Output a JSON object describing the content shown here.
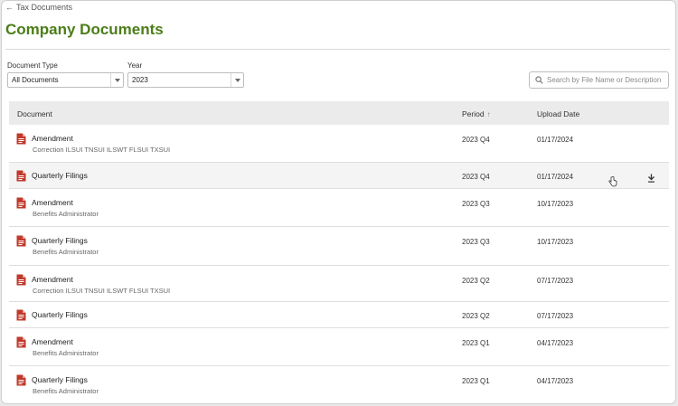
{
  "nav": {
    "back_label": "Tax Documents"
  },
  "page": {
    "title": "Company Documents"
  },
  "filters": {
    "document_type_label": "Document Type",
    "document_type_value": "All Documents",
    "year_label": "Year",
    "year_value": "2023",
    "search_placeholder": "Search by File Name or Description"
  },
  "table": {
    "columns": {
      "document": "Document",
      "period": "Period",
      "upload_date": "Upload Date"
    },
    "rows": [
      {
        "name": "Amendment",
        "desc": "Correction ILSUI TNSUI ILSWT FLSUI TXSUI",
        "period": "2023 Q4",
        "date": "01/17/2024"
      },
      {
        "name": "Quarterly Filings",
        "desc": "",
        "period": "2023 Q4",
        "date": "01/17/2024"
      },
      {
        "name": "Amendment",
        "desc": "Benefits Administrator",
        "period": "2023 Q3",
        "date": "10/17/2023"
      },
      {
        "name": "Quarterly Filings",
        "desc": "Benefits Administrator",
        "period": "2023 Q3",
        "date": "10/17/2023"
      },
      {
        "name": "Amendment",
        "desc": "Correction ILSUI TNSUI ILSWT FLSUI TXSUI",
        "period": "2023 Q2",
        "date": "07/17/2023"
      },
      {
        "name": "Quarterly Filings",
        "desc": "",
        "period": "2023 Q2",
        "date": "07/17/2023"
      },
      {
        "name": "Amendment",
        "desc": "Benefits Administrator",
        "period": "2023 Q1",
        "date": "04/17/2023"
      },
      {
        "name": "Quarterly Filings",
        "desc": "Benefits Administrator",
        "period": "2023 Q1",
        "date": "04/17/2023"
      }
    ]
  },
  "icons": {
    "doc": "pdf-document-icon",
    "download": "download-icon",
    "search": "search-icon",
    "back": "arrow-left-icon",
    "sort": "sort-ascending-icon"
  },
  "colors": {
    "brand_green": "#4b7d18",
    "doc_icon_red": "#c0392b"
  }
}
